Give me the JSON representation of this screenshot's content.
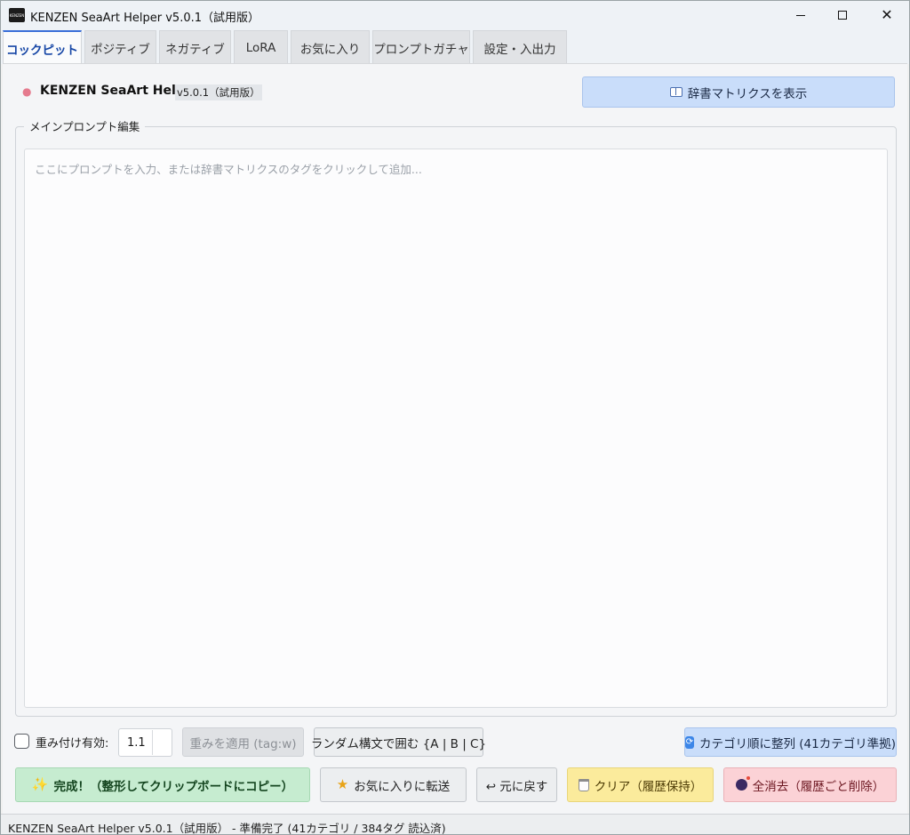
{
  "window": {
    "title": "KENZEN SeaArt Helper v5.0.1（試用版）",
    "icon_text": "KENZEN"
  },
  "tabs": [
    {
      "label": "コックピット",
      "active": true
    },
    {
      "label": "ポジティブ",
      "active": false
    },
    {
      "label": "ネガティブ",
      "active": false
    },
    {
      "label": "LoRA",
      "active": false
    },
    {
      "label": "お気に入り",
      "active": false
    },
    {
      "label": "プロンプトガチャ",
      "active": false
    },
    {
      "label": "設定・入出力",
      "active": false
    }
  ],
  "header": {
    "icon": "brain-icon",
    "title": "KENZEN SeaArt Helper",
    "version": "v5.0.1（試用版）",
    "dict_button": "辞書マトリクスを表示"
  },
  "editor": {
    "group_label": "メインプロンプト編集",
    "placeholder": "ここにプロンプトを入力、または辞書マトリクスのタグをクリックして追加..."
  },
  "controls": {
    "weight_checkbox_label": "重み付け有効:",
    "weight_checked": false,
    "weight_value": "1.1",
    "apply_weight": "重みを適用 (tag:w)",
    "random_syntax": "ランダム構文で囲む {A | B | C}",
    "sort_button": "カテゴリ順に整列 (41カテゴリ準拠)"
  },
  "actions": {
    "done": "完成！（整形してクリップボードにコピー）",
    "to_favorites": "お気に入りに転送",
    "undo": "↩ 元に戻す",
    "clear": "クリア（履歴保持）",
    "erase_all": "全消去（履歴ごと削除）"
  },
  "status": {
    "text": "KENZEN SeaArt Helper v5.0.1（試用版） - 準備完了 (41カテゴリ / 384タグ 読込済)"
  },
  "colors": {
    "accent_blue": "#c9ddfa",
    "done_green": "#c6ecd0",
    "clear_yellow": "#fbeb9c",
    "erase_pink": "#fbd2d6",
    "active_tab_text": "#1747a6"
  }
}
